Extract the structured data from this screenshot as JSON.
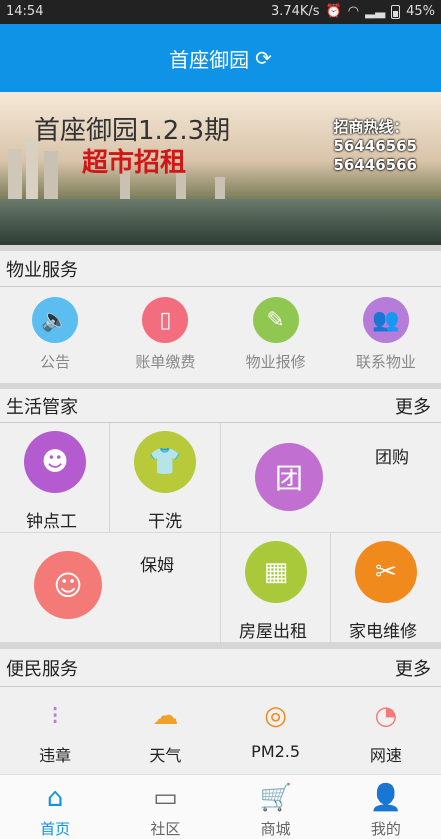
{
  "status_bar": {
    "time": "14:54",
    "speed": "3.74K/s",
    "battery": "45%"
  },
  "header": {
    "title": "首座御园"
  },
  "banner": {
    "title": "首座御园1.2.3期",
    "subtitle": "超市招租",
    "hotline_label": "招商热线：",
    "phone1": "56446565",
    "phone2": "56446566"
  },
  "property_services": {
    "title": "物业服务",
    "items": [
      {
        "label": "公告",
        "icon": "speaker-icon",
        "color": "#5bbdf0"
      },
      {
        "label": "账单缴费",
        "icon": "payment-icon",
        "color": "#f26d7d"
      },
      {
        "label": "物业报修",
        "icon": "repair-form-icon",
        "color": "#8fc751"
      },
      {
        "label": "联系物业",
        "icon": "contacts-icon",
        "color": "#b57cd9"
      }
    ]
  },
  "life_manager": {
    "title": "生活管家",
    "more": "更多",
    "items": [
      {
        "label": "钟点工",
        "icon": "maid-icon",
        "color": "#b45bd0"
      },
      {
        "label": "干洗",
        "icon": "shirt-icon",
        "color": "#b8c93a"
      },
      {
        "label": "团购",
        "icon": "group-buy-icon",
        "color": "#c26fd2"
      },
      {
        "label": "保姆",
        "icon": "nanny-icon",
        "color": "#f47a78"
      },
      {
        "label": "房屋出租",
        "icon": "building-icon",
        "color": "#a9c93a"
      },
      {
        "label": "家电维修",
        "icon": "tools-icon",
        "color": "#f18a1d"
      }
    ]
  },
  "convenience": {
    "title": "便民服务",
    "more": "更多",
    "items": [
      {
        "label": "违章",
        "icon": "traffic-light-icon",
        "color": "#b57cd9"
      },
      {
        "label": "天气",
        "icon": "weather-icon",
        "color": "#f0a12a"
      },
      {
        "label": "PM2.5",
        "icon": "pm25-icon",
        "color": "#f18a1d"
      },
      {
        "label": "网速",
        "icon": "speedometer-icon",
        "color": "#f47a78"
      }
    ]
  },
  "bottom_nav": {
    "items": [
      {
        "label": "首页",
        "icon": "home-icon",
        "active": true
      },
      {
        "label": "社区",
        "icon": "chat-icon",
        "active": false
      },
      {
        "label": "商城",
        "icon": "cart-icon",
        "active": false
      },
      {
        "label": "我的",
        "icon": "user-icon",
        "active": false
      }
    ]
  }
}
